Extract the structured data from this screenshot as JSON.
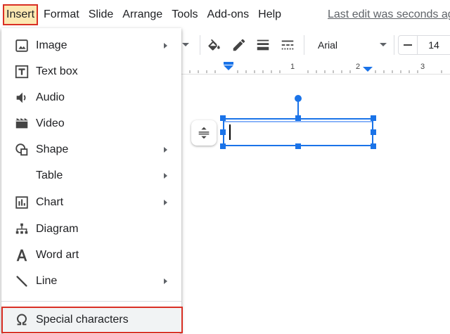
{
  "menubar": {
    "items": [
      "Insert",
      "Format",
      "Slide",
      "Arrange",
      "Tools",
      "Add-ons",
      "Help"
    ],
    "last_edit": "Last edit was seconds ago"
  },
  "toolbar": {
    "font": "Arial",
    "font_size": "14",
    "icons": [
      "paint-bucket-icon",
      "pencil-icon",
      "line-weight-icon",
      "line-dash-icon"
    ]
  },
  "ruler": {
    "labels": [
      "1",
      "2",
      "3"
    ]
  },
  "insert_menu": {
    "items": [
      {
        "label": "Image",
        "icon": "image-icon",
        "submenu": true
      },
      {
        "label": "Text box",
        "icon": "text-box-icon",
        "submenu": false
      },
      {
        "label": "Audio",
        "icon": "audio-icon",
        "submenu": false
      },
      {
        "label": "Video",
        "icon": "video-icon",
        "submenu": false
      },
      {
        "label": "Shape",
        "icon": "shape-icon",
        "submenu": true
      },
      {
        "label": "Table",
        "icon": "",
        "submenu": true
      },
      {
        "label": "Chart",
        "icon": "chart-icon",
        "submenu": true
      },
      {
        "label": "Diagram",
        "icon": "diagram-icon",
        "submenu": false
      },
      {
        "label": "Word art",
        "icon": "word-art-icon",
        "submenu": false
      },
      {
        "label": "Line",
        "icon": "line-icon",
        "submenu": true
      },
      {
        "label": "Special characters",
        "icon": "omega-icon",
        "submenu": false
      }
    ]
  },
  "colors": {
    "accent": "#1a73e8",
    "highlight_border": "#d93025",
    "active_menu_bg": "#fce8b2"
  }
}
